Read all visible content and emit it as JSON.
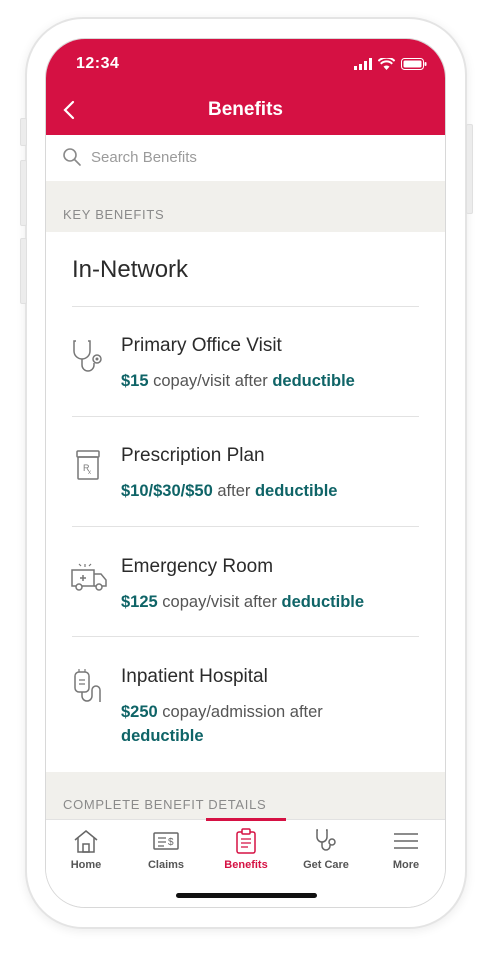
{
  "status_bar": {
    "time": "12:34"
  },
  "header": {
    "title": "Benefits"
  },
  "search": {
    "placeholder": "Search Benefits"
  },
  "sections": {
    "key_benefits": "KEY BENEFITS",
    "complete_details": "COMPLETE BENEFIT DETAILS"
  },
  "card": {
    "title": "In-Network",
    "items": [
      {
        "name": "Primary Office Visit",
        "icon": "stethoscope-icon",
        "amount": "$15",
        "middle": " copay/visit after ",
        "link": "deductible"
      },
      {
        "name": "Prescription Plan",
        "icon": "prescription-bottle-icon",
        "amount": "$10/$30/$50",
        "middle": " after ",
        "link": "deductible"
      },
      {
        "name": "Emergency Room",
        "icon": "ambulance-icon",
        "amount": "$125",
        "middle": " copay/visit after ",
        "link": "deductible"
      },
      {
        "name": "Inpatient Hospital",
        "icon": "iv-bag-icon",
        "amount": "$250",
        "middle": " copay/admission after ",
        "link": "deductible"
      }
    ]
  },
  "tabs": [
    {
      "label": "Home",
      "icon": "home-icon"
    },
    {
      "label": "Claims",
      "icon": "claims-icon"
    },
    {
      "label": "Benefits",
      "icon": "clipboard-icon",
      "active": true
    },
    {
      "label": "Get Care",
      "icon": "stethoscope-icon"
    },
    {
      "label": "More",
      "icon": "menu-icon"
    }
  ],
  "colors": {
    "brand": "#d51143",
    "accent": "#0f6467",
    "section_bg": "#f1f0ec"
  }
}
